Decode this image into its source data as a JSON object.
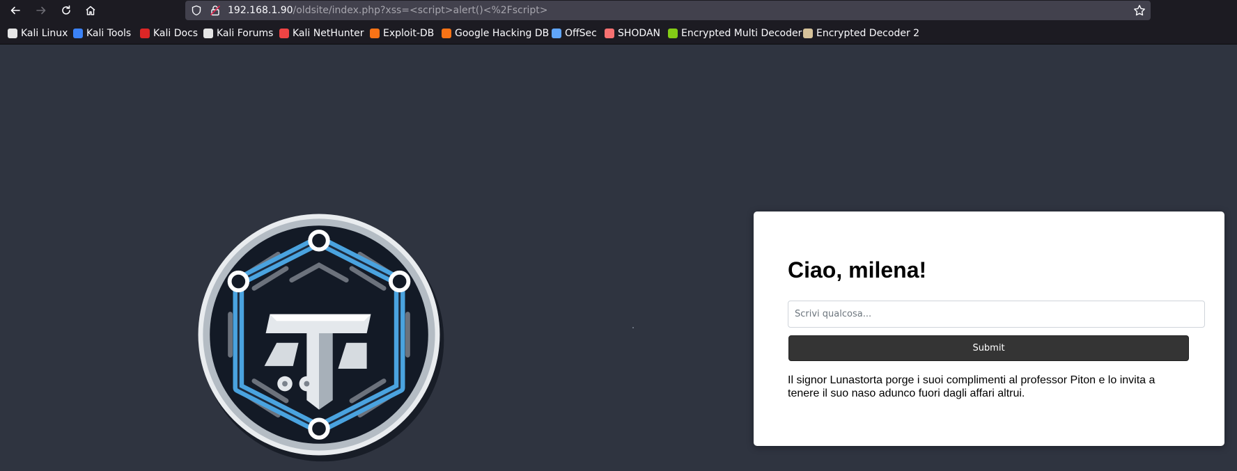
{
  "browser": {
    "url_host": "192.168.1.90",
    "url_path": "/oldsite/index.php?xss=<script>alert()<%2Fscript>"
  },
  "bookmarks": [
    {
      "label": "Kali Linux",
      "icon": "kali-dragon-icon",
      "color": "#e6e6e6"
    },
    {
      "label": "Kali Tools",
      "icon": "kali-tools-icon",
      "color": "#3b82f6"
    },
    {
      "label": "Kali Docs",
      "icon": "kali-docs-icon",
      "color": "#dc2626"
    },
    {
      "label": "Kali Forums",
      "icon": "kali-dragon-icon",
      "color": "#e6e6e6"
    },
    {
      "label": "Kali NetHunter",
      "icon": "nethunter-icon",
      "color": "#ef4444"
    },
    {
      "label": "Exploit-DB",
      "icon": "exploit-db-icon",
      "color": "#f97316"
    },
    {
      "label": "Google Hacking DB",
      "icon": "exploit-db-icon",
      "color": "#f97316"
    },
    {
      "label": "OffSec",
      "icon": "offsec-icon",
      "color": "#60a5fa"
    },
    {
      "label": "SHODAN",
      "icon": "shodan-icon",
      "color": "#f87171"
    },
    {
      "label": "Encrypted Multi Decoder",
      "icon": "decoder-icon",
      "color": "#84cc16"
    },
    {
      "label": "Encrypted Decoder 2",
      "icon": "decoder2-icon",
      "color": "#d6c29a"
    }
  ],
  "card": {
    "greeting": "Ciao, milena!",
    "input_placeholder": "Scrivi qualcosa...",
    "submit_label": "Submit",
    "message": "Il signor Lunastorta porge i suoi complimenti al professor Piton e lo invita a tenere il suo naso adunco fuori dagli affari altrui."
  },
  "colors": {
    "page_background": "#2f3440",
    "logo_blue": "#4aa3df",
    "button_background": "#343434"
  }
}
